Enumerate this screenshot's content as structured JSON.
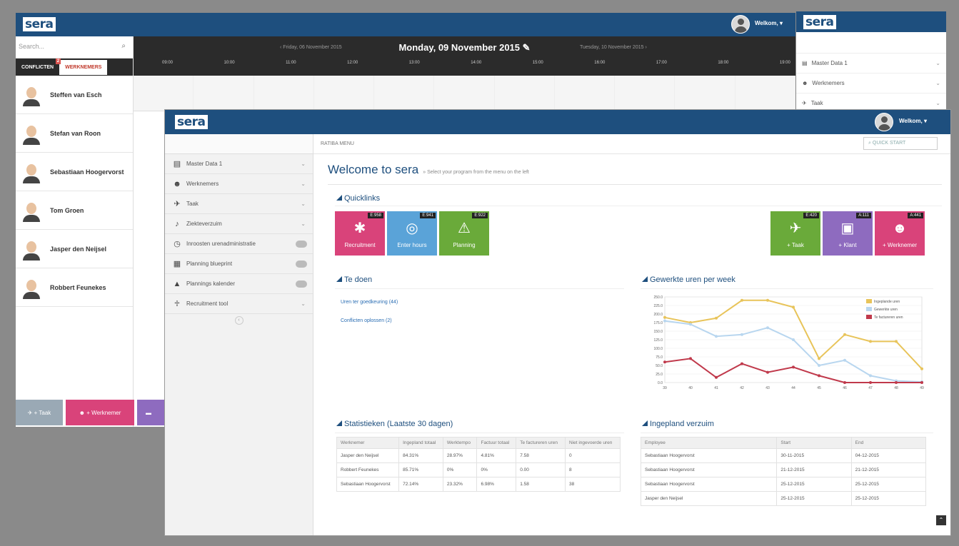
{
  "back_window": {
    "logo": "sera",
    "user_label": "Welkom,",
    "search_placeholder": "Search...",
    "tab_conflicten": "CONFLICTEN",
    "tab_conflicten_badge": "2",
    "tab_werknemers": "WERKNEMERS",
    "employees": [
      "Steffen van Esch",
      "Stefan van Roon",
      "Sebastiaan Hoogervorst",
      "Tom Groen",
      "Jasper den Neijsel",
      "Robbert Feunekes"
    ],
    "date_prev": "‹ Friday, 06 November 2015",
    "date_current": "Monday, 09 November 2015",
    "date_next": "Tuesday, 10 November 2015 ›",
    "hours": [
      "09:00",
      "10:00",
      "11:00",
      "12:00",
      "13:00",
      "14:00",
      "15:00",
      "16:00",
      "17:00",
      "18:00",
      "19:00"
    ],
    "btn_taak": "+ Taak",
    "btn_werknemer": "+ Werknemer",
    "btn_klant": "+ Klant",
    "color_taak": "#9aa9b5",
    "color_werknemer": "#d9437a",
    "color_klant": "#8e6bbf"
  },
  "strip": {
    "logo": "sera",
    "items": [
      "Master Data 1",
      "Werknemers",
      "Taak"
    ]
  },
  "front": {
    "logo": "sera",
    "user_label": "Welkom,",
    "breadcrumb": "RATIBA MENU",
    "quick_start": "QUICK START",
    "welcome_title": "Welcome to sera",
    "welcome_sub": "» Select your program from the menu on the left",
    "nav": [
      {
        "label": "Master Data 1",
        "icon": "building-icon",
        "type": "chevron"
      },
      {
        "label": "Werknemers",
        "icon": "users-icon",
        "type": "chevron"
      },
      {
        "label": "Taak",
        "icon": "megaphone-icon",
        "type": "chevron"
      },
      {
        "label": "Ziekteverzuim",
        "icon": "bell-icon",
        "type": "chevron"
      },
      {
        "label": "Inroosten urenadministratie",
        "icon": "clock-icon",
        "type": "pill"
      },
      {
        "label": "Planning blueprint",
        "icon": "calendar-icon",
        "type": "pill"
      },
      {
        "label": "Plannings kalender",
        "icon": "warning-icon",
        "type": "pill"
      },
      {
        "label": "Recruitment tool",
        "icon": "person-icon",
        "type": "chevron"
      }
    ],
    "quicklinks_title": "Quicklinks",
    "tiles_left": [
      {
        "label": "Recruitment",
        "count": "E:958",
        "color": "#d9437a",
        "icon": "network-icon",
        "glyph": "✱"
      },
      {
        "label": "Enter hours",
        "count": "E:941",
        "color": "#5aa3d8",
        "icon": "target-icon",
        "glyph": "◎"
      },
      {
        "label": "Planning",
        "count": "E:922",
        "color": "#6aaa3a",
        "icon": "warning-icon",
        "glyph": "⚠"
      }
    ],
    "tiles_right": [
      {
        "label": "+ Taak",
        "count": "E:420",
        "color": "#6aaa3a",
        "icon": "megaphone-icon",
        "glyph": "✈"
      },
      {
        "label": "+ Klant",
        "count": "A:111",
        "color": "#8e6bbf",
        "icon": "briefcase-icon",
        "glyph": "▣"
      },
      {
        "label": "+ Werknemer",
        "count": "A:441",
        "color": "#d9437a",
        "icon": "users-icon",
        "glyph": "☻"
      }
    ],
    "todo_title": "Te doen",
    "todo_items": [
      "Uren ter goedkeuring (44)",
      "Conflicten oplossen (2)"
    ],
    "chart_title": "Gewerkte uren per week",
    "stats_title": "Statistieken (Laatste 30 dagen)",
    "stats_headers": [
      "Werknemer",
      "Ingepland totaal",
      "Werktempo",
      "Factuur totaal",
      "Te factureren uren",
      "Niet ingevoerde uren"
    ],
    "stats_rows": [
      [
        "Jasper den Neijsel",
        "84.31%",
        "28.97%",
        "4.81%",
        "7.58",
        "0"
      ],
      [
        "Robbert Feunekes",
        "85.71%",
        "0%",
        "0%",
        "0.00",
        "8"
      ],
      [
        "Sebastiaan Hoogervorst",
        "72.14%",
        "23.32%",
        "6.98%",
        "1.58",
        "38"
      ]
    ],
    "absence_title": "Ingepland verzuim",
    "absence_headers": [
      "Employee",
      "Start",
      "End"
    ],
    "absence_rows": [
      [
        "Sebastiaan Hoogervorst",
        "30-11-2015",
        "04-12-2015"
      ],
      [
        "Sebastiaan Hoogervorst",
        "21-12-2015",
        "21-12-2015"
      ],
      [
        "Sebastiaan Hoogervorst",
        "25-12-2015",
        "25-12-2015"
      ],
      [
        "Jasper den Neijsel",
        "25-12-2015",
        "25-12-2015"
      ]
    ]
  },
  "chart_data": {
    "type": "line",
    "title": "Gewerkte uren per week",
    "x": [
      "39",
      "40",
      "41",
      "42",
      "43",
      "44",
      "45",
      "46",
      "47",
      "48",
      "49"
    ],
    "ylim": [
      0,
      250
    ],
    "yticks": [
      "0.0",
      "25.0",
      "50.0",
      "75.0",
      "100.0",
      "125.0",
      "150.0",
      "175.0",
      "200.0",
      "225.0",
      "250.0"
    ],
    "legend_position": "top-right",
    "series": [
      {
        "name": "Ingeplande uren",
        "color": "#e8c45a",
        "values": [
          190,
          175,
          188,
          240,
          240,
          220,
          70,
          140,
          120,
          120,
          40
        ]
      },
      {
        "name": "Gewerkte uren",
        "color": "#b8d6ef",
        "values": [
          180,
          170,
          135,
          140,
          160,
          125,
          50,
          65,
          20,
          5,
          2
        ]
      },
      {
        "name": "Te factureren uren",
        "color": "#c0394b",
        "values": [
          60,
          70,
          15,
          55,
          30,
          45,
          20,
          0,
          0,
          0,
          0
        ]
      }
    ]
  }
}
